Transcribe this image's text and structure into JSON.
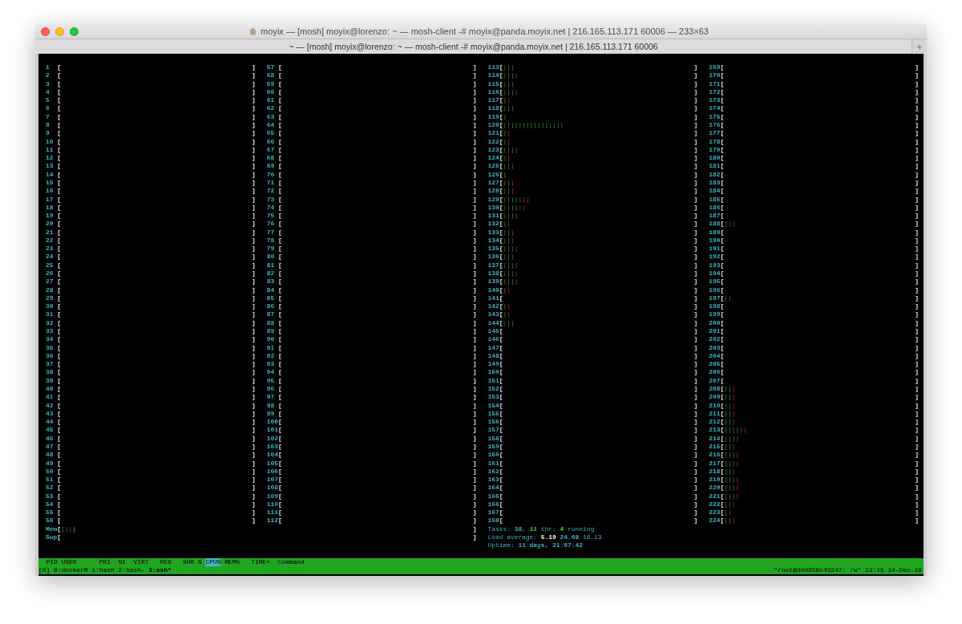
{
  "window": {
    "title": "moyix — [mosh] moyix@lorenzo: ~ — mosh-client -# moyix@panda.moyix.net | 216.165.113.171 60006 — 233×63",
    "tab": {
      "label": "~ — [mosh] moyix@lorenzo: ~ — mosh-client -# moyix@panda.moyix.net | 216.165.113.171 60006",
      "selected": true
    },
    "new_tab": "+"
  },
  "cpus": [
    {
      "num": "1",
      "open": "[",
      "close": "]"
    },
    {
      "num": "2",
      "open": "[",
      "close": "]"
    },
    {
      "num": "3",
      "open": "[",
      "close": "]"
    },
    {
      "num": "4",
      "open": "[",
      "close": "]"
    },
    {
      "num": "5",
      "open": "[",
      "close": "]"
    },
    {
      "num": "6",
      "open": "[",
      "close": "]"
    },
    {
      "num": "7",
      "open": "[",
      "close": "]"
    },
    {
      "num": "8",
      "open": "[",
      "close": "]"
    },
    {
      "num": "9",
      "open": "[",
      "close": "]"
    },
    {
      "num": "10",
      "open": "[",
      "close": "]"
    },
    {
      "num": "11",
      "open": "[",
      "close": "]"
    },
    {
      "num": "12",
      "open": "[",
      "close": "]"
    },
    {
      "num": "13",
      "open": "[",
      "close": "]"
    },
    {
      "num": "14",
      "open": "[",
      "close": "]"
    },
    {
      "num": "15",
      "open": "[",
      "close": "]"
    },
    {
      "num": "16",
      "open": "[",
      "close": "]"
    },
    {
      "num": "17",
      "open": "[",
      "close": "]"
    },
    {
      "num": "18",
      "open": "[",
      "close": "]"
    },
    {
      "num": "19",
      "open": "[",
      "close": "]"
    },
    {
      "num": "20",
      "open": "[",
      "close": "]"
    },
    {
      "num": "21",
      "open": "[",
      "close": "]"
    },
    {
      "num": "22",
      "open": "[",
      "close": "]"
    },
    {
      "num": "23",
      "open": "[",
      "close": "]"
    },
    {
      "num": "24",
      "open": "[",
      "close": "]"
    },
    {
      "num": "25",
      "open": "[",
      "close": "]"
    },
    {
      "num": "26",
      "open": "[",
      "close": "]"
    },
    {
      "num": "27",
      "open": "[",
      "close": "]"
    },
    {
      "num": "28",
      "open": "[",
      "close": "]"
    },
    {
      "num": "29",
      "open": "[",
      "close": "]"
    },
    {
      "num": "30",
      "open": "[",
      "close": "]"
    },
    {
      "num": "31",
      "open": "[",
      "close": "]"
    },
    {
      "num": "32",
      "open": "[",
      "close": "]"
    },
    {
      "num": "33",
      "open": "[",
      "close": "]"
    },
    {
      "num": "34",
      "open": "[",
      "close": "]"
    },
    {
      "num": "35",
      "open": "[",
      "close": "]"
    },
    {
      "num": "36",
      "open": "[",
      "close": "]"
    },
    {
      "num": "37",
      "open": "[",
      "close": "]"
    },
    {
      "num": "38",
      "open": "[",
      "close": "]"
    },
    {
      "num": "39",
      "open": "[",
      "close": "]"
    },
    {
      "num": "40",
      "open": "[",
      "close": "]"
    },
    {
      "num": "41",
      "open": "[",
      "close": "]"
    },
    {
      "num": "42",
      "open": "[",
      "close": "]"
    },
    {
      "num": "43",
      "open": "[",
      "close": "]"
    },
    {
      "num": "44",
      "open": "[",
      "close": "]"
    },
    {
      "num": "45",
      "open": "[",
      "close": "]"
    },
    {
      "num": "46",
      "open": "[",
      "close": "]"
    },
    {
      "num": "47",
      "open": "[",
      "close": "]"
    },
    {
      "num": "48",
      "open": "[",
      "close": "]"
    },
    {
      "num": "49",
      "open": "[",
      "close": "]"
    },
    {
      "num": "50",
      "open": "[",
      "close": "]"
    },
    {
      "num": "51",
      "open": "[",
      "close": "]"
    },
    {
      "num": "52",
      "open": "[",
      "close": "]"
    },
    {
      "num": "53",
      "open": "[",
      "close": "]"
    },
    {
      "num": "54",
      "open": "[",
      "close": "]"
    },
    {
      "num": "55",
      "open": "[",
      "close": "]"
    },
    {
      "num": "56",
      "open": "[",
      "close": "]"
    },
    {
      "num": "57",
      "open": "[",
      "close": "]"
    },
    {
      "num": "58",
      "open": "[",
      "close": "]"
    },
    {
      "num": "59",
      "open": "[",
      "close": "]"
    },
    {
      "num": "60",
      "open": "[",
      "close": "]"
    },
    {
      "num": "61",
      "open": "[",
      "close": "]"
    },
    {
      "num": "62",
      "open": "[",
      "close": "]"
    },
    {
      "num": "63",
      "open": "[",
      "close": "]"
    },
    {
      "num": "64",
      "open": "[",
      "close": "]"
    },
    {
      "num": "65",
      "open": "[",
      "close": "]"
    },
    {
      "num": "66",
      "open": "[",
      "close": "]"
    },
    {
      "num": "67",
      "open": "[",
      "close": "]"
    },
    {
      "num": "68",
      "open": "[",
      "close": "]"
    },
    {
      "num": "69",
      "open": "[",
      "close": "]"
    },
    {
      "num": "70",
      "open": "[",
      "close": "]"
    },
    {
      "num": "71",
      "open": "[",
      "close": "]"
    },
    {
      "num": "72",
      "open": "[",
      "close": "]"
    },
    {
      "num": "73",
      "open": "[",
      "close": "]"
    },
    {
      "num": "74",
      "open": "[",
      "close": "]"
    },
    {
      "num": "75",
      "open": "[",
      "close": "]"
    },
    {
      "num": "76",
      "open": "[",
      "close": "]"
    },
    {
      "num": "77",
      "open": "[",
      "close": "]"
    },
    {
      "num": "78",
      "open": "[",
      "close": "]"
    },
    {
      "num": "79",
      "open": "[",
      "close": "]"
    },
    {
      "num": "80",
      "open": "[",
      "close": "]"
    },
    {
      "num": "81",
      "open": "[",
      "close": "]"
    },
    {
      "num": "82",
      "open": "[",
      "close": "]"
    },
    {
      "num": "83",
      "open": "[",
      "close": "]"
    },
    {
      "num": "84",
      "open": "[",
      "close": "]"
    },
    {
      "num": "85",
      "open": "[",
      "close": "]"
    },
    {
      "num": "86",
      "open": "[",
      "close": "]"
    },
    {
      "num": "87",
      "open": "[",
      "close": "]"
    },
    {
      "num": "88",
      "open": "[",
      "close": "]"
    },
    {
      "num": "89",
      "open": "[",
      "close": "]"
    },
    {
      "num": "90",
      "open": "[",
      "close": "]"
    },
    {
      "num": "91",
      "open": "[",
      "close": "]"
    },
    {
      "num": "92",
      "open": "[",
      "close": "]"
    },
    {
      "num": "93",
      "open": "[",
      "close": "]"
    },
    {
      "num": "94",
      "open": "[",
      "close": "]"
    },
    {
      "num": "95",
      "open": "[",
      "close": "]"
    },
    {
      "num": "96",
      "open": "[",
      "close": "]"
    },
    {
      "num": "97",
      "open": "[",
      "close": "]"
    },
    {
      "num": "98",
      "open": "[",
      "close": "]"
    },
    {
      "num": "99",
      "open": "[",
      "close": "]"
    },
    {
      "num": "100",
      "open": "[",
      "close": "]"
    },
    {
      "num": "101",
      "open": "[",
      "close": "]"
    },
    {
      "num": "102",
      "open": "[",
      "close": "]"
    },
    {
      "num": "103",
      "open": "[",
      "close": "]"
    },
    {
      "num": "104",
      "open": "[",
      "close": "]"
    },
    {
      "num": "105",
      "open": "[",
      "close": "]"
    },
    {
      "num": "106",
      "open": "[",
      "close": "]"
    },
    {
      "num": "107",
      "open": "[",
      "close": "]"
    },
    {
      "num": "108",
      "open": "[",
      "close": "]"
    },
    {
      "num": "109",
      "open": "[",
      "close": "]"
    },
    {
      "num": "110",
      "open": "[",
      "close": "]"
    },
    {
      "num": "111",
      "open": "[",
      "close": "]"
    },
    {
      "num": "112",
      "open": "[",
      "close": "]"
    },
    {
      "num": "113",
      "open": "[",
      "user": "||",
      "sys": "|",
      "close": "]"
    },
    {
      "num": "114",
      "open": "[",
      "user": "|||",
      "sys": "|",
      "close": "]"
    },
    {
      "num": "115",
      "open": "[",
      "user": "||",
      "sys": "|",
      "close": "]"
    },
    {
      "num": "116",
      "open": "[",
      "user": "|||",
      "sys": "|",
      "close": "]"
    },
    {
      "num": "117",
      "open": "[",
      "user": "|",
      "sys": "|",
      "close": "]"
    },
    {
      "num": "118",
      "open": "[",
      "user": "||",
      "sys": "|",
      "close": "]"
    },
    {
      "num": "119",
      "open": "[",
      "user": "|",
      "close": "]"
    },
    {
      "num": "120",
      "open": "[",
      "user": "|||||||||||||||",
      "sys": "|",
      "close": "]"
    },
    {
      "num": "121",
      "open": "[",
      "user": "|",
      "sys": "|",
      "close": "]"
    },
    {
      "num": "122",
      "open": "[",
      "user": "|",
      "sys": "|",
      "close": "]"
    },
    {
      "num": "123",
      "open": "[",
      "user": "|||",
      "sys": "|",
      "close": "]"
    },
    {
      "num": "124",
      "open": "[",
      "user": "|",
      "sys": "|",
      "close": "]"
    },
    {
      "num": "125",
      "open": "[",
      "user": "||",
      "sys": "|",
      "close": "]"
    },
    {
      "num": "126",
      "open": "[",
      "user": "|",
      "close": "]"
    },
    {
      "num": "127",
      "open": "[",
      "user": "||",
      "sys": "|",
      "close": "]"
    },
    {
      "num": "128",
      "open": "[",
      "user": "||",
      "sys": "|",
      "close": "]"
    },
    {
      "num": "129",
      "open": "[",
      "user": "|||||",
      "sys": "||",
      "close": "]"
    },
    {
      "num": "130",
      "open": "[",
      "user": "||||",
      "sys": "||",
      "close": "]"
    },
    {
      "num": "131",
      "open": "[",
      "user": "|||",
      "sys": "|",
      "close": "]"
    },
    {
      "num": "132",
      "open": "[",
      "user": "|",
      "sys": "|",
      "close": "]"
    },
    {
      "num": "133",
      "open": "[",
      "user": "||",
      "sys": "|",
      "close": "]"
    },
    {
      "num": "134",
      "open": "[",
      "user": "||",
      "sys": "|",
      "close": "]"
    },
    {
      "num": "135",
      "open": "[",
      "user": "|||",
      "sys": "|",
      "close": "]"
    },
    {
      "num": "136",
      "open": "[",
      "user": "||",
      "sys": "|",
      "close": "]"
    },
    {
      "num": "137",
      "open": "[",
      "user": "|||",
      "sys": "|",
      "close": "]"
    },
    {
      "num": "138",
      "open": "[",
      "user": "|||",
      "sys": "|",
      "close": "]"
    },
    {
      "num": "139",
      "open": "[",
      "user": "|||",
      "sys": "|",
      "close": "]"
    },
    {
      "num": "140",
      "open": "[",
      "user": "|",
      "sys": "|",
      "close": "]"
    },
    {
      "num": "141",
      "open": "[",
      "close": "]"
    },
    {
      "num": "142",
      "open": "[",
      "user": "|",
      "sys": "|",
      "close": "]"
    },
    {
      "num": "143",
      "open": "[",
      "user": "|",
      "sys": "|",
      "close": "]"
    },
    {
      "num": "144",
      "open": "[",
      "user": "||",
      "sys": "|",
      "close": "]"
    },
    {
      "num": "145",
      "open": "[",
      "close": "]"
    },
    {
      "num": "146",
      "open": "[",
      "close": "]"
    },
    {
      "num": "147",
      "open": "[",
      "close": "]"
    },
    {
      "num": "148",
      "open": "[",
      "close": "]"
    },
    {
      "num": "149",
      "open": "[",
      "close": "]"
    },
    {
      "num": "150",
      "open": "[",
      "close": "]"
    },
    {
      "num": "151",
      "open": "[",
      "close": "]"
    },
    {
      "num": "152",
      "open": "[",
      "close": "]"
    },
    {
      "num": "153",
      "open": "[",
      "close": "]"
    },
    {
      "num": "154",
      "open": "[",
      "close": "]"
    },
    {
      "num": "155",
      "open": "[",
      "close": "]"
    },
    {
      "num": "156",
      "open": "[",
      "close": "]"
    },
    {
      "num": "157",
      "open": "[",
      "close": "]"
    },
    {
      "num": "158",
      "open": "[",
      "close": "]"
    },
    {
      "num": "159",
      "open": "[",
      "close": "]"
    },
    {
      "num": "160",
      "open": "[",
      "close": "]"
    },
    {
      "num": "161",
      "open": "[",
      "close": "]"
    },
    {
      "num": "162",
      "open": "[",
      "close": "]"
    },
    {
      "num": "163",
      "open": "[",
      "close": "]"
    },
    {
      "num": "164",
      "open": "[",
      "close": "]"
    },
    {
      "num": "165",
      "open": "[",
      "close": "]"
    },
    {
      "num": "166",
      "open": "[",
      "close": "]"
    },
    {
      "num": "167",
      "open": "[",
      "close": "]"
    },
    {
      "num": "168",
      "open": "[",
      "close": "]"
    },
    {
      "num": "169",
      "open": "[",
      "close": "]"
    },
    {
      "num": "170",
      "open": "[",
      "close": "]"
    },
    {
      "num": "171",
      "open": "[",
      "close": "]"
    },
    {
      "num": "172",
      "open": "[",
      "close": "]"
    },
    {
      "num": "173",
      "open": "[",
      "close": "]"
    },
    {
      "num": "174",
      "open": "[",
      "close": "]"
    },
    {
      "num": "175",
      "open": "[",
      "close": "]"
    },
    {
      "num": "176",
      "open": "[",
      "close": "]"
    },
    {
      "num": "177",
      "open": "[",
      "close": "]"
    },
    {
      "num": "178",
      "open": "[",
      "close": "]"
    },
    {
      "num": "179",
      "open": "[",
      "close": "]"
    },
    {
      "num": "180",
      "open": "[",
      "close": "]"
    },
    {
      "num": "181",
      "open": "[",
      "close": "]"
    },
    {
      "num": "182",
      "open": "[",
      "close": "]"
    },
    {
      "num": "183",
      "open": "[",
      "close": "]"
    },
    {
      "num": "184",
      "open": "[",
      "close": "]"
    },
    {
      "num": "185",
      "open": "[",
      "close": "]"
    },
    {
      "num": "186",
      "open": "[",
      "close": "]"
    },
    {
      "num": "187",
      "open": "[",
      "close": "]"
    },
    {
      "num": "188",
      "open": "[",
      "user": "|",
      "sys": "||",
      "close": "]"
    },
    {
      "num": "189",
      "open": "[",
      "close": "]"
    },
    {
      "num": "190",
      "open": "[",
      "close": "]"
    },
    {
      "num": "191",
      "open": "[",
      "close": "]"
    },
    {
      "num": "192",
      "open": "[",
      "close": "]"
    },
    {
      "num": "193",
      "open": "[",
      "close": "]"
    },
    {
      "num": "194",
      "open": "[",
      "close": "]"
    },
    {
      "num": "195",
      "open": "[",
      "close": "]"
    },
    {
      "num": "196",
      "open": "[",
      "close": "]"
    },
    {
      "num": "197",
      "open": "[",
      "user": "|",
      "sys": "|",
      "close": "]"
    },
    {
      "num": "198",
      "open": "[",
      "close": "]"
    },
    {
      "num": "199",
      "open": "[",
      "close": "]"
    },
    {
      "num": "200",
      "open": "[",
      "close": "]"
    },
    {
      "num": "201",
      "open": "[",
      "close": "]"
    },
    {
      "num": "202",
      "open": "[",
      "close": "]"
    },
    {
      "num": "203",
      "open": "[",
      "close": "]"
    },
    {
      "num": "204",
      "open": "[",
      "close": "]"
    },
    {
      "num": "205",
      "open": "[",
      "close": "]"
    },
    {
      "num": "206",
      "open": "[",
      "close": "]"
    },
    {
      "num": "207",
      "open": "[",
      "close": "]"
    },
    {
      "num": "208",
      "open": "[",
      "user": "||",
      "sys": "|",
      "close": "]"
    },
    {
      "num": "209",
      "open": "[",
      "user": "||",
      "sys": "|",
      "close": "]"
    },
    {
      "num": "210",
      "open": "[",
      "user": "||",
      "sys": "|",
      "close": "]"
    },
    {
      "num": "211",
      "open": "[",
      "user": "||",
      "sys": "|",
      "close": "]"
    },
    {
      "num": "212",
      "open": "[",
      "user": "||",
      "sys": "|",
      "close": "]"
    },
    {
      "num": "213",
      "open": "[",
      "user": "||||",
      "sys": "||",
      "close": "]"
    },
    {
      "num": "214",
      "open": "[",
      "user": "|||",
      "sys": "|",
      "close": "]"
    },
    {
      "num": "215",
      "open": "[",
      "user": "||",
      "sys": "|",
      "close": "]"
    },
    {
      "num": "216",
      "open": "[",
      "user": "|||",
      "sys": "|",
      "close": "]"
    },
    {
      "num": "217",
      "open": "[",
      "user": "|||",
      "sys": "|",
      "close": "]"
    },
    {
      "num": "218",
      "open": "[",
      "user": "||",
      "sys": "|",
      "close": "]"
    },
    {
      "num": "219",
      "open": "[",
      "user": "|||",
      "sys": "|",
      "close": "]"
    },
    {
      "num": "220",
      "open": "[",
      "user": "|||",
      "sys": "|",
      "close": "]"
    },
    {
      "num": "221",
      "open": "[",
      "user": "|||",
      "sys": "|",
      "close": "]"
    },
    {
      "num": "222",
      "open": "[",
      "user": "||",
      "sys": "|",
      "close": "]"
    },
    {
      "num": "223",
      "open": "[",
      "user": "|",
      "sys": "|",
      "close": "]"
    },
    {
      "num": "224",
      "open": "[",
      "user": "||",
      "sys": "|",
      "close": "]"
    }
  ],
  "memory": [
    {
      "label": "Mem",
      "open": "[",
      "used": "||",
      "buffers": "|",
      "cache": "|",
      "close": "]"
    },
    {
      "label": "Swp",
      "open": "[",
      "close": "]"
    }
  ],
  "summary": [
    [
      {
        "text": "Tasks: ",
        "kind": "label"
      },
      {
        "text": "38",
        "kind": "value"
      },
      {
        "text": ", ",
        "kind": "label"
      },
      {
        "text": "11",
        "kind": "accent"
      },
      {
        "text": " thr; ",
        "kind": "label"
      },
      {
        "text": "4",
        "kind": "accent"
      },
      {
        "text": " running",
        "kind": "label"
      }
    ],
    [
      {
        "text": "Load average: ",
        "kind": "label"
      },
      {
        "text": "5.19",
        "kind": "strong"
      },
      {
        "text": " 24.08",
        "kind": "value"
      },
      {
        "text": " 16.13",
        "kind": "label"
      }
    ],
    [
      {
        "text": "Uptime: ",
        "kind": "label"
      },
      {
        "text": "11 days, 21:07:42",
        "kind": "value"
      }
    ]
  ],
  "header": {
    "columns": [
      {
        "label": "PID",
        "selected": false
      },
      {
        "label": "USER",
        "selected": false
      },
      {
        "label": "PRI",
        "selected": false
      },
      {
        "label": "NI",
        "selected": false
      },
      {
        "label": "VIRT",
        "selected": false
      },
      {
        "label": "RES",
        "selected": false
      },
      {
        "label": "SHR",
        "selected": false
      },
      {
        "label": "S",
        "selected": false
      },
      {
        "label": "CPU%",
        "selected": true
      },
      {
        "label": "MEM%",
        "selected": false
      },
      {
        "label": "TIME+",
        "selected": false
      },
      {
        "label": "Command",
        "selected": false
      }
    ]
  },
  "tmux": {
    "session": "[0]",
    "windows": [
      {
        "label": "0:dockerM",
        "selected": false
      },
      {
        "label": "1:bash",
        "selected": false
      },
      {
        "label": "2:bash-",
        "selected": false
      },
      {
        "label": "3:ssh*",
        "selected": true
      }
    ],
    "status": "\"root@ddd959c43247: /w\" 13:15 14-Dec-19"
  }
}
